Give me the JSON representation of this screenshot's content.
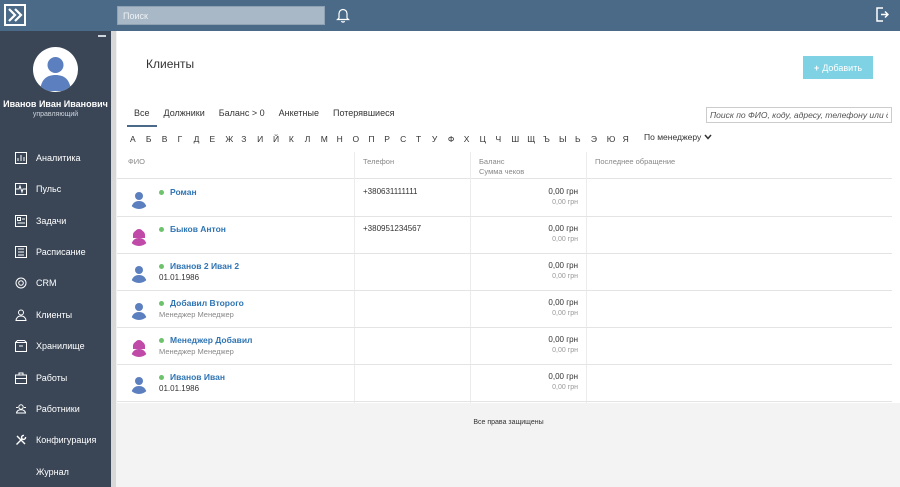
{
  "search": {
    "placeholder": "Поиск"
  },
  "user": {
    "name": "Иванов Иван Иванович",
    "role": "управляющий"
  },
  "sidebar": {
    "items": [
      {
        "label": "Аналитика",
        "icon": "analytics-icon"
      },
      {
        "label": "Пульс",
        "icon": "pulse-icon"
      },
      {
        "label": "Задачи",
        "icon": "tasks-icon"
      },
      {
        "label": "Расписание",
        "icon": "schedule-icon"
      },
      {
        "label": "CRM",
        "icon": "crm-icon"
      },
      {
        "label": "Клиенты",
        "icon": "clients-icon"
      },
      {
        "label": "Хранилище",
        "icon": "storage-icon"
      },
      {
        "label": "Работы",
        "icon": "works-icon"
      },
      {
        "label": "Работники",
        "icon": "workers-icon"
      },
      {
        "label": "Конфигурация",
        "icon": "config-icon"
      },
      {
        "label": "Журнал",
        "icon": ""
      }
    ]
  },
  "main": {
    "title": "Клиенты",
    "add_label": "Добавить",
    "tabs": [
      "Все",
      "Должники",
      "Баланс > 0",
      "Анкетные",
      "Потерявшиеся"
    ],
    "filter_placeholder": "Поиск по ФИО, коду, адресу, телефону или да",
    "alphabet": [
      "А",
      "Б",
      "В",
      "Г",
      "Д",
      "Е",
      "Ж",
      "З",
      "И",
      "Й",
      "К",
      "Л",
      "М",
      "Н",
      "О",
      "П",
      "Р",
      "С",
      "Т",
      "У",
      "Ф",
      "Х",
      "Ц",
      "Ч",
      "Ш",
      "Щ",
      "Ъ",
      "Ы",
      "Ь",
      "Э",
      "Ю",
      "Я"
    ],
    "manager_filter": "По менеджеру",
    "columns": {
      "name": "ФИО",
      "phone": "Телефон",
      "balance": "Баланс",
      "receipts": "Сумма чеков",
      "last_visit": "Последнее обращение"
    },
    "rows": [
      {
        "name": "Роман",
        "sub": "",
        "phone": "+380631111111",
        "balance": "0,00 грн",
        "receipts": "0,00 грн",
        "gender": "male"
      },
      {
        "name": "Быков Антон",
        "sub": "",
        "phone": "+380951234567",
        "balance": "0,00 грн",
        "receipts": "0,00 грн",
        "gender": "female"
      },
      {
        "name": "Иванов 2 Иван 2",
        "sub": "01.01.1986",
        "phone": "",
        "balance": "0,00 грн",
        "receipts": "0,00 грн",
        "gender": "male"
      },
      {
        "name": "Добавил Второго",
        "sub": "Менеджер Менеджер",
        "phone": "",
        "balance": "0,00 грн",
        "receipts": "0,00 грн",
        "gender": "male"
      },
      {
        "name": "Менеджер Добавил",
        "sub": "Менеджер Менеджер",
        "phone": "",
        "balance": "0,00 грн",
        "receipts": "0,00 грн",
        "gender": "female"
      },
      {
        "name": "Иванов Иван",
        "sub": "01.01.1986",
        "phone": "",
        "balance": "0,00 грн",
        "receipts": "0,00 грн",
        "gender": "male"
      }
    ]
  },
  "footer": {
    "text": "Все права защищены"
  },
  "colors": {
    "topbar": "#4a6a87",
    "sidebar": "#3a4656",
    "accent": "#7fd2e3",
    "link": "#2f74b3",
    "online": "#6cc36c",
    "male_avatar": "#5b7fbf",
    "female_avatar": "#c04aa8"
  }
}
